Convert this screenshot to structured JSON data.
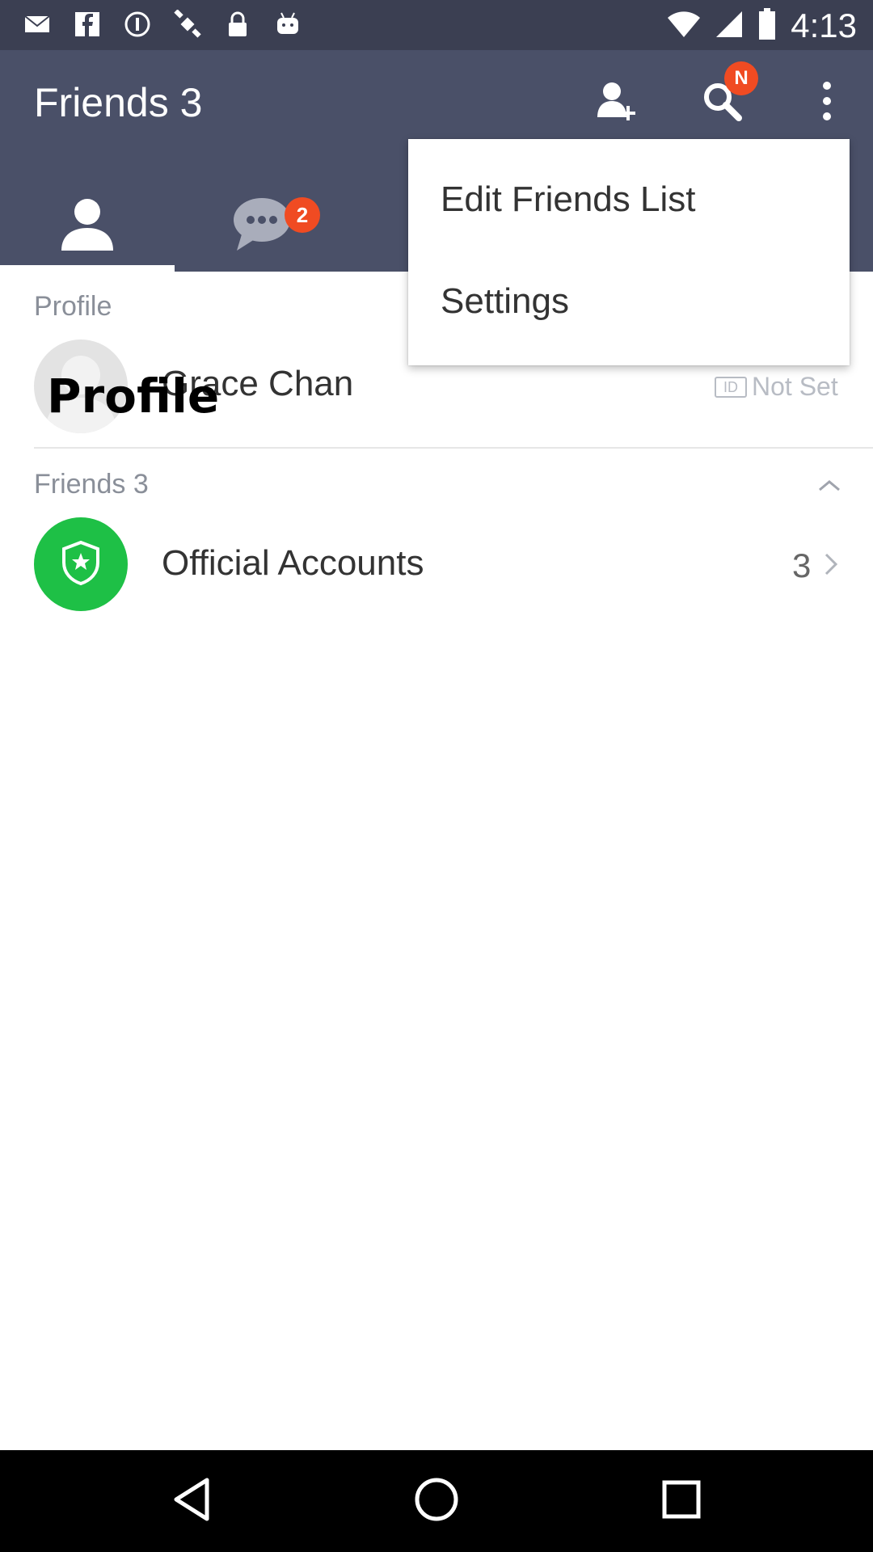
{
  "status_bar": {
    "time": "4:13",
    "left_icons": [
      "mail-icon",
      "facebook-icon",
      "info-icon",
      "satellite-icon",
      "lock-icon",
      "android-icon"
    ],
    "right_icons": [
      "wifi-icon",
      "signal-icon",
      "battery-icon"
    ]
  },
  "header": {
    "title": "Friends 3",
    "search_badge": "N",
    "actions": [
      "add-friend-icon",
      "search-icon",
      "more-icon"
    ]
  },
  "tabs": {
    "friends_icon": "person-icon",
    "chats_icon": "chat-bubble-icon",
    "chats_badge": "2"
  },
  "dropdown": {
    "items": [
      {
        "label": "Edit Friends List"
      },
      {
        "label": "Settings"
      }
    ]
  },
  "profile_section": {
    "label": "Profile",
    "overlay_label": "Profile",
    "name": "Grace Chan",
    "id_badge": "ID",
    "id_value": "Not Set"
  },
  "friends_section": {
    "label": "Friends 3",
    "official_accounts_label": "Official Accounts",
    "official_accounts_count": "3"
  },
  "colors": {
    "appbar": "#4a5068",
    "statusbar": "#3b3f52",
    "badge": "#f04b22",
    "official_green": "#1ec046"
  }
}
